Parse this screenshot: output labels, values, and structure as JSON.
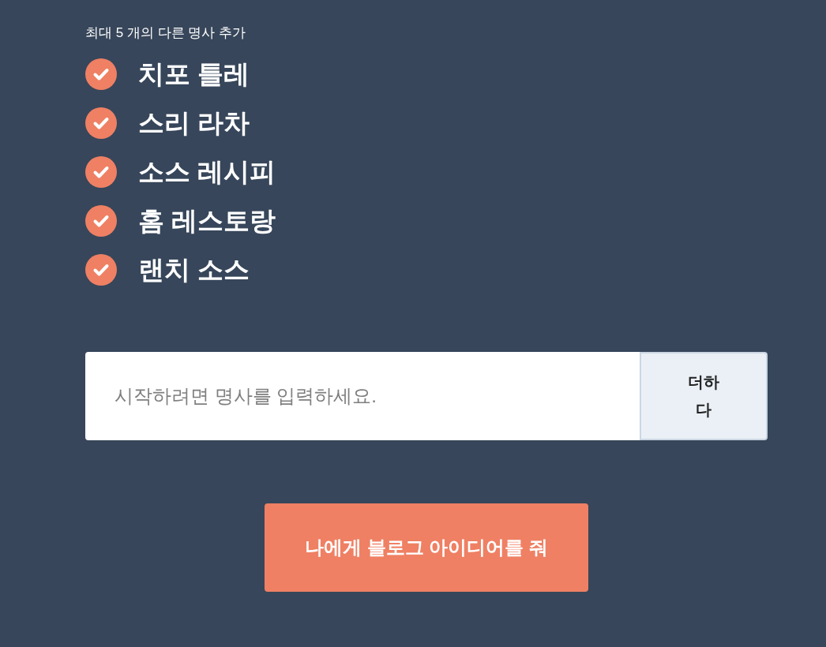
{
  "heading": "최대 5 개의 다른 명사 추가",
  "nouns": [
    "치포 틀레",
    "스리 라차",
    "소스 레시피",
    "홈 레스토랑",
    "랜치 소스"
  ],
  "noun_input": {
    "placeholder": "시작하려면 명사를 입력하세요."
  },
  "add_button": {
    "label": "더하다"
  },
  "submit_button": {
    "label": "나에게 블로그 아이디어를 줘"
  }
}
